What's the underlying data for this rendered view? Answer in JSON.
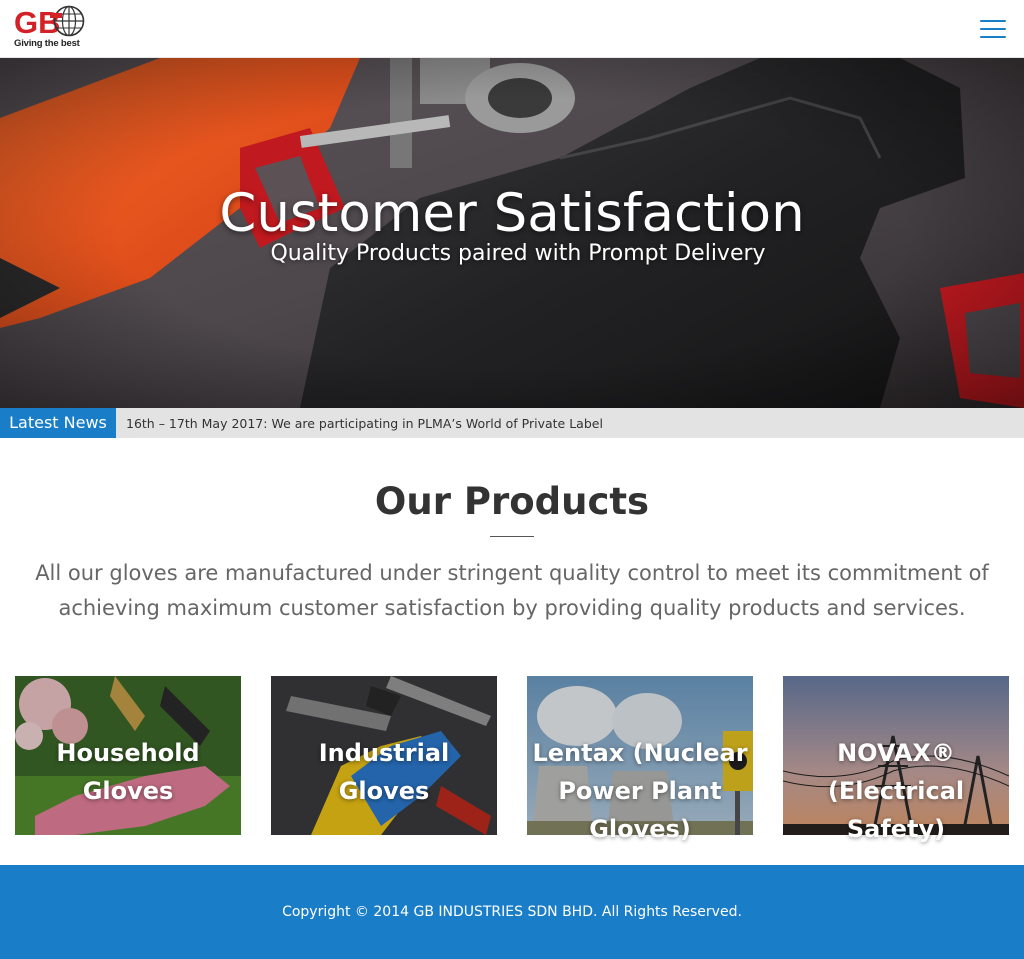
{
  "header": {
    "logo_alt": "GB",
    "logo_tagline": "Giving the best",
    "menu_icon": "hamburger-menu-icon"
  },
  "hero": {
    "title": "Customer Satisfaction",
    "subtitle": "Quality Products paired with Prompt Delivery"
  },
  "news": {
    "label": "Latest News",
    "headline": "16th – 17th May 2017: We are participating in PLMA’s World of Private Label"
  },
  "products": {
    "title": "Our Products",
    "description": "All our gloves are manufactured under stringent quality control to meet its commitment of achieving maximum customer satisfaction by providing quality products and services.",
    "items": [
      {
        "label": "Household Gloves"
      },
      {
        "label": "Industrial Gloves"
      },
      {
        "label": "Lentax (Nuclear Power Plant Gloves)"
      },
      {
        "label": "NOVAX® (Electrical Safety)"
      }
    ]
  },
  "footer": {
    "copyright": "Copyright © 2014 GB INDUSTRIES SDN BHD. All Rights Reserved."
  },
  "colors": {
    "brand_blue": "#1a7dc7",
    "logo_red": "#d42027",
    "news_bar": "#e3e3e3"
  }
}
